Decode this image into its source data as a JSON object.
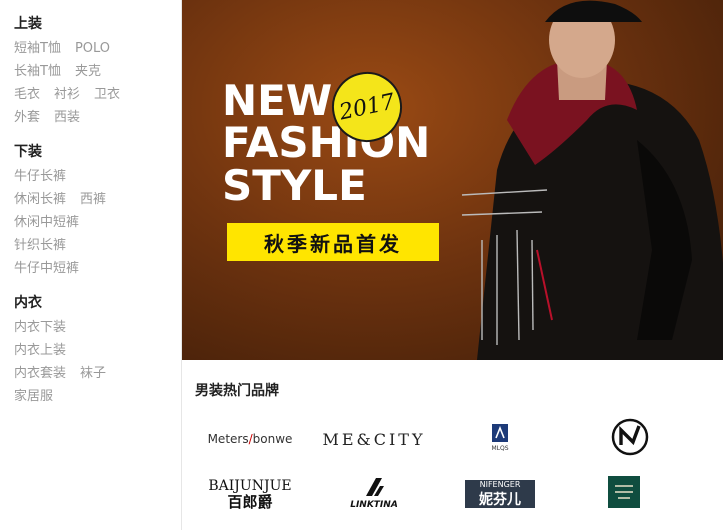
{
  "categories": [
    {
      "title": "上装",
      "rows": [
        [
          "短袖T恤",
          "POLO"
        ],
        [
          "长袖T恤",
          "夹克"
        ],
        [
          "毛衣",
          "衬衫",
          "卫衣"
        ],
        [
          "外套",
          "西装"
        ]
      ]
    },
    {
      "title": "下装",
      "rows": [
        [
          "牛仔长裤"
        ],
        [
          "休闲长裤",
          "西裤"
        ],
        [
          "休闲中短裤"
        ],
        [
          "针织长裤"
        ],
        [
          "牛仔中短裤"
        ]
      ]
    },
    {
      "title": "内衣",
      "rows": [
        [
          "内衣下装"
        ],
        [
          "内衣上装"
        ],
        [
          "内衣套装",
          "袜子"
        ],
        [
          "家居服"
        ]
      ]
    }
  ],
  "hero": {
    "line1": "NEW",
    "line2": "FASHION",
    "line3": "STYLE",
    "badge": "2017",
    "tag": "秋季新品首发"
  },
  "brands": {
    "title": "男装热门品牌",
    "meters_a": "Meters",
    "meters_b": "bonwe",
    "mecity": "ME&CITY",
    "bai_en": "BAIJUNJUE",
    "bai_cn": "百郎爵",
    "linktina": "LINKTINA",
    "nifen_en": "NIFENGER",
    "nifen_cn": "妮芬儿",
    "mlqs": "MLQS"
  },
  "colors": {
    "accent": "#ffe500",
    "hero_bg": "#6e330f",
    "muted_text": "#999999"
  }
}
